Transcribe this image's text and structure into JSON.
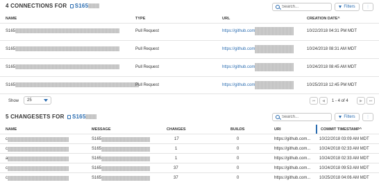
{
  "connections": {
    "title_prefix": "4 CONNECTIONS FOR",
    "project_visible": "S165",
    "search_placeholder": "Search...",
    "filters_label": "Filters",
    "columns": [
      "NAME",
      "TYPE",
      "URL",
      "CREATION DATE"
    ],
    "sort_indicator": "^",
    "rows": [
      {
        "name": "S165",
        "type": "Pull Request",
        "url": "https://github.com",
        "date": "10/22/2018 04:31 PM MDT"
      },
      {
        "name": "S165",
        "type": "Pull Request",
        "url": "https://github.com",
        "date": "10/24/2018 08:31 AM MDT"
      },
      {
        "name": "S165",
        "type": "Pull Request",
        "url": "https://github.com",
        "date": "10/24/2018 08:45 AM MDT"
      },
      {
        "name": "S165",
        "type": "Pull Request",
        "url": "https://github.com",
        "date": "10/25/2018 12:45 PM MDT"
      }
    ],
    "show_label": "Show",
    "page_size": "25",
    "page_info": "1 - 4 of 4"
  },
  "changesets": {
    "title_prefix": "5 CHANGESETS FOR",
    "project_visible": "S165",
    "search_placeholder": "Search...",
    "filters_label": "Filters",
    "columns": [
      "NAME",
      "MESSAGE",
      "CHANGES",
      "BUILDS",
      "URI",
      "COMMIT TIMESTAMP"
    ],
    "sort_indicator": "^",
    "rows": [
      {
        "name": "c",
        "message": "S165",
        "changes": "17",
        "builds": "0",
        "uri": "https://github.com...",
        "timestamp": "10/22/2018 03:09 AM MDT"
      },
      {
        "name": "c",
        "message": "S165",
        "changes": "1",
        "builds": "0",
        "uri": "https://github.com...",
        "timestamp": "10/24/2018 02:33 AM MDT"
      },
      {
        "name": "a",
        "message": "S165",
        "changes": "1",
        "builds": "0",
        "uri": "https://github.com...",
        "timestamp": "10/24/2018 02:33 AM MDT"
      },
      {
        "name": "c",
        "message": "S165",
        "changes": "37",
        "builds": "0",
        "uri": "https://github.com...",
        "timestamp": "10/24/2018 09:53 AM MDT"
      },
      {
        "name": "c",
        "message": "S165",
        "changes": "37",
        "builds": "0",
        "uri": "https://github.com...",
        "timestamp": "10/25/2018 04:06 AM MDT"
      }
    ]
  },
  "colors": {
    "accent": "#2a6cb0",
    "text": "#333333",
    "border": "#e3e3e3"
  },
  "icons": [
    "project-icon",
    "search-icon",
    "filter-icon",
    "column-settings-icon",
    "first-page-icon",
    "prev-page-icon",
    "next-page-icon",
    "last-page-icon",
    "dropdown-caret-icon"
  ]
}
